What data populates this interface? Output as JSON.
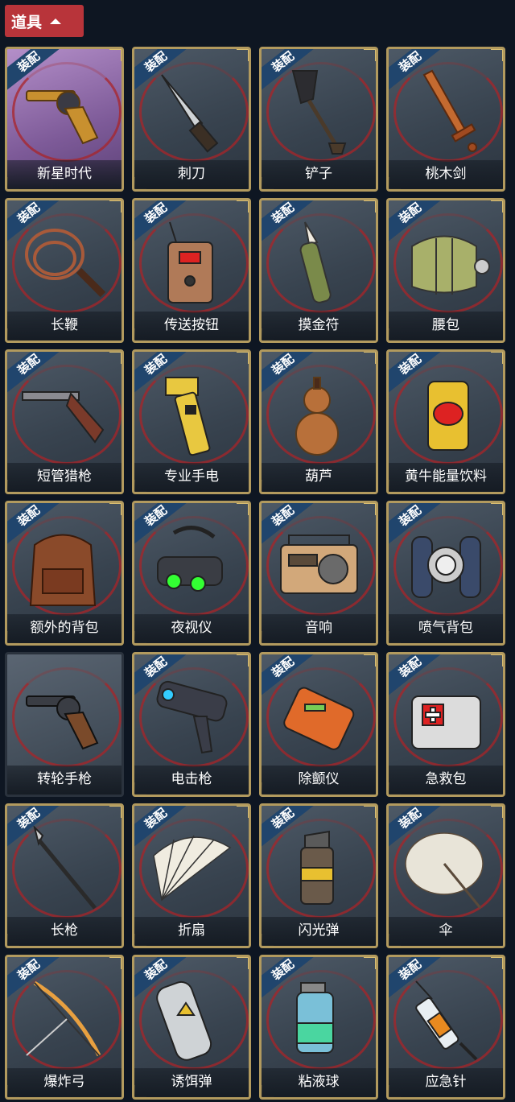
{
  "header": {
    "title": "道具"
  },
  "equip_tag": "装配",
  "items": [
    {
      "label": "新星时代",
      "icon": "revolver-gold-icon",
      "tagged": true,
      "selected": true
    },
    {
      "label": "刺刀",
      "icon": "bayonet-icon",
      "tagged": true
    },
    {
      "label": "铲子",
      "icon": "shovel-icon",
      "tagged": true
    },
    {
      "label": "桃木剑",
      "icon": "wooden-sword-icon",
      "tagged": true
    },
    {
      "label": "长鞭",
      "icon": "whip-icon",
      "tagged": true
    },
    {
      "label": "传送按钮",
      "icon": "teleport-button-icon",
      "tagged": true
    },
    {
      "label": "摸金符",
      "icon": "claw-talisman-icon",
      "tagged": true
    },
    {
      "label": "腰包",
      "icon": "waist-bag-icon",
      "tagged": true
    },
    {
      "label": "短管猎枪",
      "icon": "shotgun-icon",
      "tagged": true
    },
    {
      "label": "专业手电",
      "icon": "flashlight-icon",
      "tagged": true
    },
    {
      "label": "葫芦",
      "icon": "gourd-icon",
      "tagged": true
    },
    {
      "label": "黄牛能量饮料",
      "icon": "energy-drink-icon",
      "tagged": true
    },
    {
      "label": "额外的背包",
      "icon": "backpack-icon",
      "tagged": true
    },
    {
      "label": "夜视仪",
      "icon": "night-vision-icon",
      "tagged": true
    },
    {
      "label": "音响",
      "icon": "radio-icon",
      "tagged": true
    },
    {
      "label": "喷气背包",
      "icon": "jetpack-icon",
      "tagged": true
    },
    {
      "label": "转轮手枪",
      "icon": "revolver-icon",
      "tagged": false
    },
    {
      "label": "电击枪",
      "icon": "shock-gun-icon",
      "tagged": true
    },
    {
      "label": "除颤仪",
      "icon": "defibrillator-icon",
      "tagged": true
    },
    {
      "label": "急救包",
      "icon": "first-aid-kit-icon",
      "tagged": true
    },
    {
      "label": "长枪",
      "icon": "spear-icon",
      "tagged": true
    },
    {
      "label": "折扇",
      "icon": "folding-fan-icon",
      "tagged": true
    },
    {
      "label": "闪光弹",
      "icon": "flashbang-icon",
      "tagged": true
    },
    {
      "label": "伞",
      "icon": "umbrella-icon",
      "tagged": true
    },
    {
      "label": "爆炸弓",
      "icon": "bow-icon",
      "tagged": true
    },
    {
      "label": "诱饵弹",
      "icon": "decoy-grenade-icon",
      "tagged": true
    },
    {
      "label": "粘液球",
      "icon": "slime-ball-icon",
      "tagged": true
    },
    {
      "label": "应急针",
      "icon": "syringe-icon",
      "tagged": true
    }
  ]
}
